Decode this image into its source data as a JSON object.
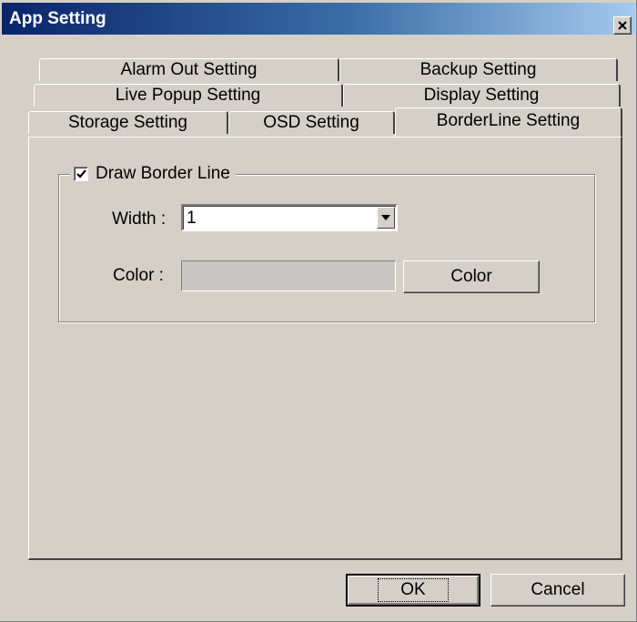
{
  "window": {
    "title": "App Setting",
    "close_glyph": "✕"
  },
  "tabs": {
    "row1": [
      {
        "label": "Alarm Out Setting"
      },
      {
        "label": "Backup Setting"
      }
    ],
    "row2": [
      {
        "label": "Live Popup Setting"
      },
      {
        "label": "Display Setting"
      }
    ],
    "row3": [
      {
        "label": "Storage Setting"
      },
      {
        "label": "OSD Setting"
      },
      {
        "label": "BorderLine Setting",
        "active": true
      }
    ]
  },
  "border_group": {
    "checkbox_label": "Draw Border Line",
    "checked": true,
    "width_label": "Width :",
    "width_value": "1",
    "color_label": "Color :",
    "color_button": "Color",
    "swatch_color": "#c8c6c2"
  },
  "footer": {
    "ok_label": "OK",
    "cancel_label": "Cancel"
  },
  "colors": {
    "face": "#d4d0c8",
    "title_start": "#0a246a",
    "title_end": "#a6caf0"
  }
}
